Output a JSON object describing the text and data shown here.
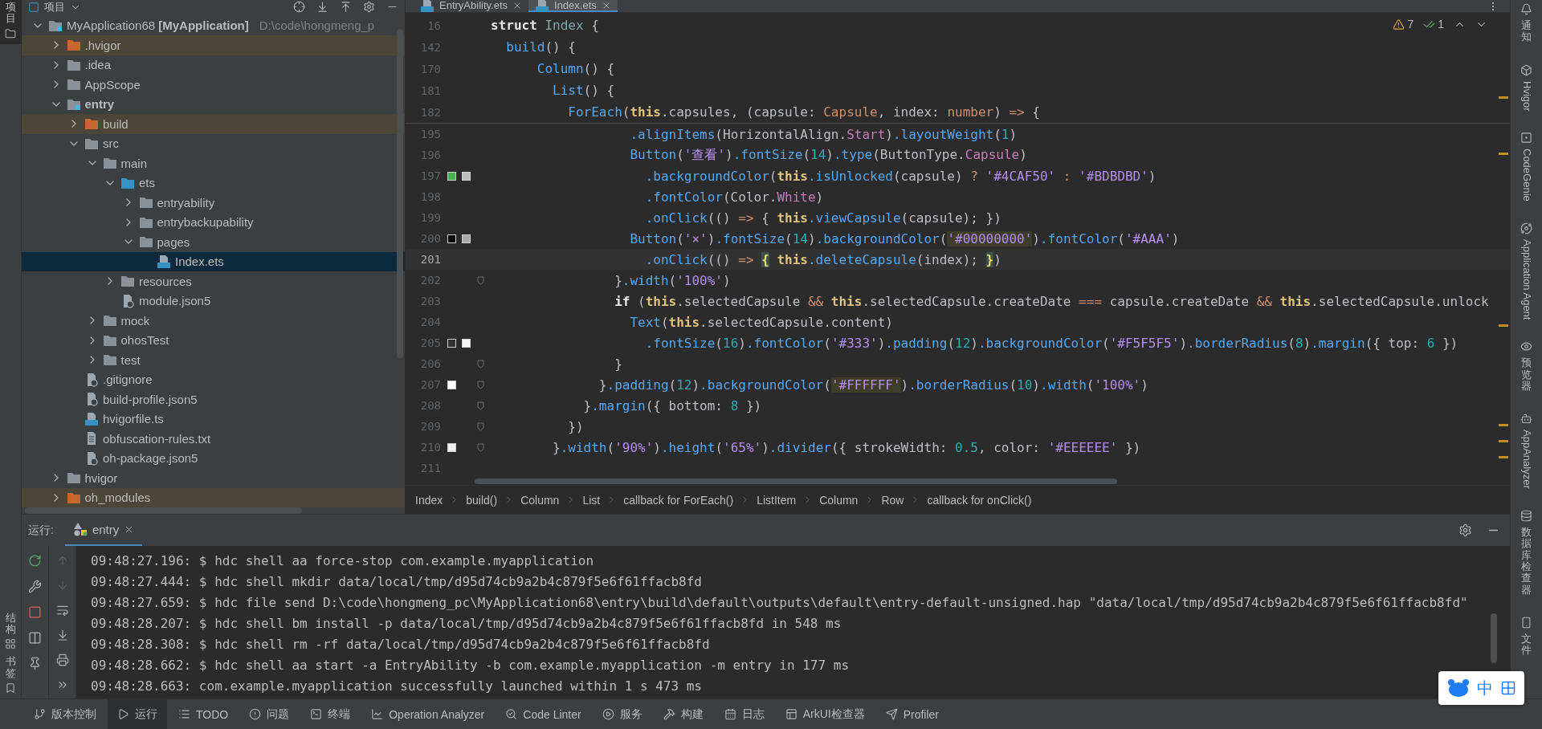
{
  "left_strip": [
    {
      "label": "项目",
      "selected": true
    },
    {
      "label": "结构",
      "selected": false
    },
    {
      "label": "书签",
      "selected": false
    }
  ],
  "project_panel": {
    "title": "项目",
    "tree": [
      {
        "label": "MyApplication68",
        "tag": "[MyApplication]",
        "path": "D:\\code\\hongmeng_p",
        "kind": "project",
        "expanded": true,
        "selected": false,
        "excluded": false,
        "children": [
          {
            "label": ".hvigor",
            "kind": "folder",
            "expanded": false,
            "selected": false,
            "excluded": true
          },
          {
            "label": ".idea",
            "kind": "folder",
            "expanded": false,
            "selected": false,
            "excluded": false
          },
          {
            "label": "AppScope",
            "kind": "folder",
            "expanded": false,
            "selected": false,
            "excluded": false
          },
          {
            "label": "entry",
            "kind": "module",
            "expanded": true,
            "selected": false,
            "excluded": false,
            "children": [
              {
                "label": "build",
                "kind": "folder",
                "expanded": false,
                "selected": false,
                "excluded": true
              },
              {
                "label": "src",
                "kind": "folder",
                "expanded": true,
                "selected": false,
                "excluded": false,
                "children": [
                  {
                    "label": "main",
                    "kind": "folder",
                    "expanded": true,
                    "selected": false,
                    "excluded": false,
                    "children": [
                      {
                        "label": "ets",
                        "kind": "source-folder",
                        "expanded": true,
                        "selected": false,
                        "excluded": false,
                        "children": [
                          {
                            "label": "entryability",
                            "kind": "folder",
                            "expanded": false,
                            "selected": false,
                            "excluded": false
                          },
                          {
                            "label": "entrybackupability",
                            "kind": "folder",
                            "expanded": false,
                            "selected": false,
                            "excluded": false
                          },
                          {
                            "label": "pages",
                            "kind": "folder",
                            "expanded": true,
                            "selected": false,
                            "excluded": false,
                            "children": [
                              {
                                "label": "Index.ets",
                                "kind": "ets-file",
                                "selected": true,
                                "excluded": false
                              }
                            ]
                          }
                        ]
                      },
                      {
                        "label": "resources",
                        "kind": "folder",
                        "expanded": false,
                        "selected": false,
                        "excluded": false
                      },
                      {
                        "label": "module.json5",
                        "kind": "json-file",
                        "selected": false,
                        "excluded": false
                      }
                    ]
                  },
                  {
                    "label": "mock",
                    "kind": "folder",
                    "expanded": false,
                    "selected": false,
                    "excluded": false
                  },
                  {
                    "label": "ohosTest",
                    "kind": "folder",
                    "expanded": false,
                    "selected": false,
                    "excluded": false
                  },
                  {
                    "label": "test",
                    "kind": "folder",
                    "expanded": false,
                    "selected": false,
                    "excluded": false
                  }
                ]
              },
              {
                "label": ".gitignore",
                "kind": "ignore-file",
                "selected": false,
                "excluded": false
              },
              {
                "label": "build-profile.json5",
                "kind": "json-file",
                "selected": false,
                "excluded": false
              },
              {
                "label": "hvigorfile.ts",
                "kind": "ts-file",
                "selected": false,
                "excluded": false
              },
              {
                "label": "obfuscation-rules.txt",
                "kind": "text-file",
                "selected": false,
                "excluded": false
              },
              {
                "label": "oh-package.json5",
                "kind": "json-file",
                "selected": false,
                "excluded": false
              }
            ]
          },
          {
            "label": "hvigor",
            "kind": "folder",
            "expanded": false,
            "selected": false,
            "excluded": false
          },
          {
            "label": "oh_modules",
            "kind": "folder",
            "expanded": false,
            "selected": false,
            "excluded": true
          }
        ]
      }
    ]
  },
  "editor": {
    "tabs": [
      {
        "label": "EntryAbility.ets",
        "selected": false
      },
      {
        "label": "Index.ets",
        "selected": true
      }
    ],
    "problems": {
      "warnings": "7",
      "passed": "1"
    },
    "sticky_lines": [
      {
        "number": "16",
        "current": false,
        "fold": false,
        "tokens": [
          {
            "kind": "bold",
            "text": "struct"
          },
          {
            "kind": "name",
            "text": " Index"
          },
          {
            "kind": "plain",
            "text": " {"
          }
        ]
      },
      {
        "number": "142",
        "current": false,
        "fold": false,
        "tokens": [
          {
            "kind": "fn",
            "text": "  build"
          },
          {
            "kind": "plain",
            "text": "() {"
          }
        ]
      },
      {
        "number": "170",
        "current": false,
        "fold": false,
        "tokens": [
          {
            "kind": "fn",
            "text": "      Column"
          },
          {
            "kind": "plain",
            "text": "() {"
          }
        ]
      },
      {
        "number": "181",
        "current": false,
        "fold": false,
        "tokens": [
          {
            "kind": "fn",
            "text": "        List"
          },
          {
            "kind": "plain",
            "text": "() {"
          }
        ]
      },
      {
        "number": "182",
        "current": false,
        "fold": false,
        "tokens": [
          {
            "kind": "fn",
            "text": "          ForEach"
          },
          {
            "kind": "plain",
            "text": "("
          },
          {
            "kind": "this",
            "text": "this"
          },
          {
            "kind": "plain",
            "text": ".capsules, (capsule: "
          },
          {
            "kind": "type",
            "text": "Capsule"
          },
          {
            "kind": "plain",
            "text": ", index: "
          },
          {
            "kind": "type",
            "text": "number"
          },
          {
            "kind": "plain",
            "text": ") "
          },
          {
            "kind": "op",
            "text": "=>"
          },
          {
            "kind": "plain",
            "text": " {"
          }
        ]
      }
    ],
    "lines": [
      {
        "number": "195",
        "current": false,
        "fold": false,
        "tokens": [
          {
            "kind": "fn",
            "text": "                  .alignItems"
          },
          {
            "kind": "plain",
            "text": "(HorizontalAlign."
          },
          {
            "kind": "enum",
            "text": "Start"
          },
          {
            "kind": "plain",
            "text": ")"
          },
          {
            "kind": "fn",
            "text": ".layoutWeight"
          },
          {
            "kind": "plain",
            "text": "("
          },
          {
            "kind": "num",
            "text": "1"
          },
          {
            "kind": "plain",
            "text": ")"
          }
        ]
      },
      {
        "number": "196",
        "current": false,
        "fold": false,
        "tokens": [
          {
            "kind": "fn",
            "text": "                  Button"
          },
          {
            "kind": "plain",
            "text": "("
          },
          {
            "kind": "str",
            "text": "'查看'"
          },
          {
            "kind": "plain",
            "text": ")"
          },
          {
            "kind": "fn",
            "text": ".fontSize"
          },
          {
            "kind": "plain",
            "text": "("
          },
          {
            "kind": "num",
            "text": "14"
          },
          {
            "kind": "plain",
            "text": ")"
          },
          {
            "kind": "fn",
            "text": ".type"
          },
          {
            "kind": "plain",
            "text": "(ButtonType."
          },
          {
            "kind": "enum",
            "text": "Capsule"
          },
          {
            "kind": "plain",
            "text": ")"
          }
        ]
      },
      {
        "number": "197",
        "current": false,
        "fold": false,
        "swatches": [
          {
            "color": "#4caf50"
          },
          {
            "color": "#bdbdbd"
          }
        ],
        "tokens": [
          {
            "kind": "fn",
            "text": "                    .backgroundColor"
          },
          {
            "kind": "plain",
            "text": "("
          },
          {
            "kind": "this",
            "text": "this"
          },
          {
            "kind": "fn",
            "text": ".isUnlocked"
          },
          {
            "kind": "plain",
            "text": "(capsule) "
          },
          {
            "kind": "op",
            "text": "?"
          },
          {
            "kind": "str",
            "text": " '#4CAF50'"
          },
          {
            "kind": "op",
            "text": " :"
          },
          {
            "kind": "str",
            "text": " '#BDBDBD'"
          },
          {
            "kind": "plain",
            "text": ")"
          }
        ]
      },
      {
        "number": "198",
        "current": false,
        "fold": false,
        "tokens": [
          {
            "kind": "fn",
            "text": "                    .fontColor"
          },
          {
            "kind": "plain",
            "text": "(Color."
          },
          {
            "kind": "enum",
            "text": "White"
          },
          {
            "kind": "plain",
            "text": ")"
          }
        ]
      },
      {
        "number": "199",
        "current": false,
        "fold": false,
        "tokens": [
          {
            "kind": "fn",
            "text": "                    .onClick"
          },
          {
            "kind": "plain",
            "text": "(() "
          },
          {
            "kind": "op",
            "text": "=>"
          },
          {
            "kind": "plain",
            "text": " { "
          },
          {
            "kind": "this",
            "text": "this"
          },
          {
            "kind": "fn",
            "text": ".viewCapsule"
          },
          {
            "kind": "plain",
            "text": "(capsule); })"
          }
        ]
      },
      {
        "number": "200",
        "current": false,
        "fold": false,
        "swatches": [
          {
            "color": "#000000"
          },
          {
            "color": "#aaaaaa"
          }
        ],
        "tokens": [
          {
            "kind": "fn",
            "text": "                  Button"
          },
          {
            "kind": "plain",
            "text": "("
          },
          {
            "kind": "str",
            "text": "'×'"
          },
          {
            "kind": "plain",
            "text": ")"
          },
          {
            "kind": "fn",
            "text": ".fontSize"
          },
          {
            "kind": "plain",
            "text": "("
          },
          {
            "kind": "num",
            "text": "14"
          },
          {
            "kind": "plain",
            "text": ")"
          },
          {
            "kind": "fn",
            "text": ".backgroundColor"
          },
          {
            "kind": "plain",
            "text": "("
          },
          {
            "kind": "str-mark",
            "text": "'#00000000'"
          },
          {
            "kind": "plain",
            "text": ")"
          },
          {
            "kind": "fn",
            "text": ".fontColor"
          },
          {
            "kind": "plain",
            "text": "("
          },
          {
            "kind": "str",
            "text": "'#AAA'"
          },
          {
            "kind": "plain",
            "text": ")"
          }
        ]
      },
      {
        "number": "201",
        "current": true,
        "fold": false,
        "tokens": [
          {
            "kind": "fn",
            "text": "                    .onClick"
          },
          {
            "kind": "plain",
            "text": "(() "
          },
          {
            "kind": "op",
            "text": "=> "
          },
          {
            "kind": "brace-mark",
            "text": "{"
          },
          {
            "kind": "this",
            "text": " this"
          },
          {
            "kind": "fn",
            "text": ".deleteCapsule"
          },
          {
            "kind": "plain",
            "text": "(index); "
          },
          {
            "kind": "brace-mark",
            "text": "}"
          },
          {
            "kind": "plain",
            "text": ")"
          }
        ]
      },
      {
        "number": "202",
        "current": false,
        "fold": true,
        "tokens": [
          {
            "kind": "plain",
            "text": "                }"
          },
          {
            "kind": "fn",
            "text": ".width"
          },
          {
            "kind": "plain",
            "text": "("
          },
          {
            "kind": "str",
            "text": "'100%'"
          },
          {
            "kind": "plain",
            "text": ")"
          }
        ]
      },
      {
        "number": "203",
        "current": false,
        "fold": false,
        "tokens": [
          {
            "kind": "bold",
            "text": "                if"
          },
          {
            "kind": "plain",
            "text": " ("
          },
          {
            "kind": "this",
            "text": "this"
          },
          {
            "kind": "plain",
            "text": ".selectedCapsule "
          },
          {
            "kind": "op",
            "text": "&&"
          },
          {
            "kind": "this",
            "text": " this"
          },
          {
            "kind": "plain",
            "text": ".selectedCapsule.createDate "
          },
          {
            "kind": "op",
            "text": "==="
          },
          {
            "kind": "plain",
            "text": " capsule.createDate "
          },
          {
            "kind": "op",
            "text": "&&"
          },
          {
            "kind": "this",
            "text": " this"
          },
          {
            "kind": "plain",
            "text": ".selectedCapsule.unlock"
          }
        ]
      },
      {
        "number": "204",
        "current": false,
        "fold": false,
        "tokens": [
          {
            "kind": "fn",
            "text": "                  Text"
          },
          {
            "kind": "plain",
            "text": "("
          },
          {
            "kind": "this",
            "text": "this"
          },
          {
            "kind": "plain",
            "text": ".selectedCapsule.content)"
          }
        ]
      },
      {
        "number": "205",
        "current": false,
        "fold": false,
        "swatches": [
          {
            "color": "#333333"
          },
          {
            "color": "#f5f5f5"
          }
        ],
        "tokens": [
          {
            "kind": "fn",
            "text": "                    .fontSize"
          },
          {
            "kind": "plain",
            "text": "("
          },
          {
            "kind": "num",
            "text": "16"
          },
          {
            "kind": "plain",
            "text": ")"
          },
          {
            "kind": "fn",
            "text": ".fontColor"
          },
          {
            "kind": "plain",
            "text": "("
          },
          {
            "kind": "str",
            "text": "'#333'"
          },
          {
            "kind": "plain",
            "text": ")"
          },
          {
            "kind": "fn",
            "text": ".padding"
          },
          {
            "kind": "plain",
            "text": "("
          },
          {
            "kind": "num",
            "text": "12"
          },
          {
            "kind": "plain",
            "text": ")"
          },
          {
            "kind": "fn",
            "text": ".backgroundColor"
          },
          {
            "kind": "plain",
            "text": "("
          },
          {
            "kind": "str",
            "text": "'#F5F5F5'"
          },
          {
            "kind": "plain",
            "text": ")"
          },
          {
            "kind": "fn",
            "text": ".borderRadius"
          },
          {
            "kind": "plain",
            "text": "("
          },
          {
            "kind": "num",
            "text": "8"
          },
          {
            "kind": "plain",
            "text": ")"
          },
          {
            "kind": "fn",
            "text": ".margin"
          },
          {
            "kind": "plain",
            "text": "({ top: "
          },
          {
            "kind": "num",
            "text": "6"
          },
          {
            "kind": "plain",
            "text": " })"
          }
        ]
      },
      {
        "number": "206",
        "current": false,
        "fold": true,
        "tokens": [
          {
            "kind": "plain",
            "text": "                }"
          }
        ]
      },
      {
        "number": "207",
        "current": false,
        "fold": true,
        "swatches": [
          {
            "color": "#ffffff"
          }
        ],
        "tokens": [
          {
            "kind": "plain",
            "text": "              }"
          },
          {
            "kind": "fn",
            "text": ".padding"
          },
          {
            "kind": "plain",
            "text": "("
          },
          {
            "kind": "num",
            "text": "12"
          },
          {
            "kind": "plain",
            "text": ")"
          },
          {
            "kind": "fn",
            "text": ".backgroundColor"
          },
          {
            "kind": "plain",
            "text": "("
          },
          {
            "kind": "str-mark",
            "text": "'#FFFFFF'"
          },
          {
            "kind": "plain",
            "text": ")"
          },
          {
            "kind": "fn",
            "text": ".borderRadius"
          },
          {
            "kind": "plain",
            "text": "("
          },
          {
            "kind": "num",
            "text": "10"
          },
          {
            "kind": "plain",
            "text": ")"
          },
          {
            "kind": "fn",
            "text": ".width"
          },
          {
            "kind": "plain",
            "text": "("
          },
          {
            "kind": "str",
            "text": "'100%'"
          },
          {
            "kind": "plain",
            "text": ")"
          }
        ]
      },
      {
        "number": "208",
        "current": false,
        "fold": true,
        "tokens": [
          {
            "kind": "plain",
            "text": "            }"
          },
          {
            "kind": "fn",
            "text": ".margin"
          },
          {
            "kind": "plain",
            "text": "({ bottom: "
          },
          {
            "kind": "num",
            "text": "8"
          },
          {
            "kind": "plain",
            "text": " })"
          }
        ]
      },
      {
        "number": "209",
        "current": false,
        "fold": true,
        "tokens": [
          {
            "kind": "plain",
            "text": "          })"
          }
        ]
      },
      {
        "number": "210",
        "current": false,
        "fold": true,
        "swatches": [
          {
            "color": "#eeeeee"
          }
        ],
        "tokens": [
          {
            "kind": "plain",
            "text": "        }"
          },
          {
            "kind": "fn",
            "text": ".width"
          },
          {
            "kind": "plain",
            "text": "("
          },
          {
            "kind": "str",
            "text": "'90%'"
          },
          {
            "kind": "plain",
            "text": ")"
          },
          {
            "kind": "fn",
            "text": ".height"
          },
          {
            "kind": "plain",
            "text": "("
          },
          {
            "kind": "str",
            "text": "'65%'"
          },
          {
            "kind": "plain",
            "text": ")"
          },
          {
            "kind": "fn",
            "text": ".divider"
          },
          {
            "kind": "plain",
            "text": "({ strokeWidth: "
          },
          {
            "kind": "num",
            "text": "0.5"
          },
          {
            "kind": "plain",
            "text": ", color: "
          },
          {
            "kind": "str",
            "text": "'#EEEEEE'"
          },
          {
            "kind": "plain",
            "text": " })"
          }
        ]
      },
      {
        "number": "211",
        "current": false,
        "fold": false
      }
    ],
    "breadcrumb": [
      "Index",
      "build()",
      "Column",
      "List",
      "callback for ForEach()",
      "ListItem",
      "Column",
      "Row",
      "callback for onClick()"
    ]
  },
  "run_panel": {
    "label": "运行:",
    "tabs": [
      {
        "label": "entry",
        "selected": true
      }
    ],
    "console": [
      "09:48:27.196: $ hdc shell aa force-stop com.example.myapplication",
      "09:48:27.444: $ hdc shell mkdir data/local/tmp/d95d74cb9a2b4c879f5e6f61ffacb8fd",
      "09:48:27.659: $ hdc file send D:\\code\\hongmeng_pc\\MyApplication68\\entry\\build\\default\\outputs\\default\\entry-default-unsigned.hap \"data/local/tmp/d95d74cb9a2b4c879f5e6f61ffacb8fd\"",
      "09:48:28.207: $ hdc shell bm install -p data/local/tmp/d95d74cb9a2b4c879f5e6f61ffacb8fd in 548 ms",
      "09:48:28.308: $ hdc shell rm -rf data/local/tmp/d95d74cb9a2b4c879f5e6f61ffacb8fd",
      "09:48:28.662: $ hdc shell aa start -a EntryAbility -b com.example.myapplication -m entry in 177 ms",
      "09:48:28.663: com.example.myapplication successfully launched within 1 s 473 ms"
    ]
  },
  "right_strip": [
    "通知",
    "Hvigor",
    "CodeGenie",
    "Application Agent",
    "预览器",
    "AppAnalyzer",
    "数据库检查器",
    "文件"
  ],
  "bottom_toolbar": [
    {
      "label": "版本控制",
      "selected": false
    },
    {
      "label": "运行",
      "selected": true
    },
    {
      "label": "TODO",
      "selected": false
    },
    {
      "label": "问题",
      "selected": false
    },
    {
      "label": "终端",
      "selected": false
    },
    {
      "label": "Operation Analyzer",
      "selected": false
    },
    {
      "label": "Code Linter",
      "selected": false
    },
    {
      "label": "服务",
      "selected": false
    },
    {
      "label": "构建",
      "selected": false
    },
    {
      "label": "日志",
      "selected": false
    },
    {
      "label": "ArkUI检查器",
      "selected": false
    },
    {
      "label": "Profiler",
      "selected": false
    }
  ],
  "ime": {
    "label": "中"
  }
}
